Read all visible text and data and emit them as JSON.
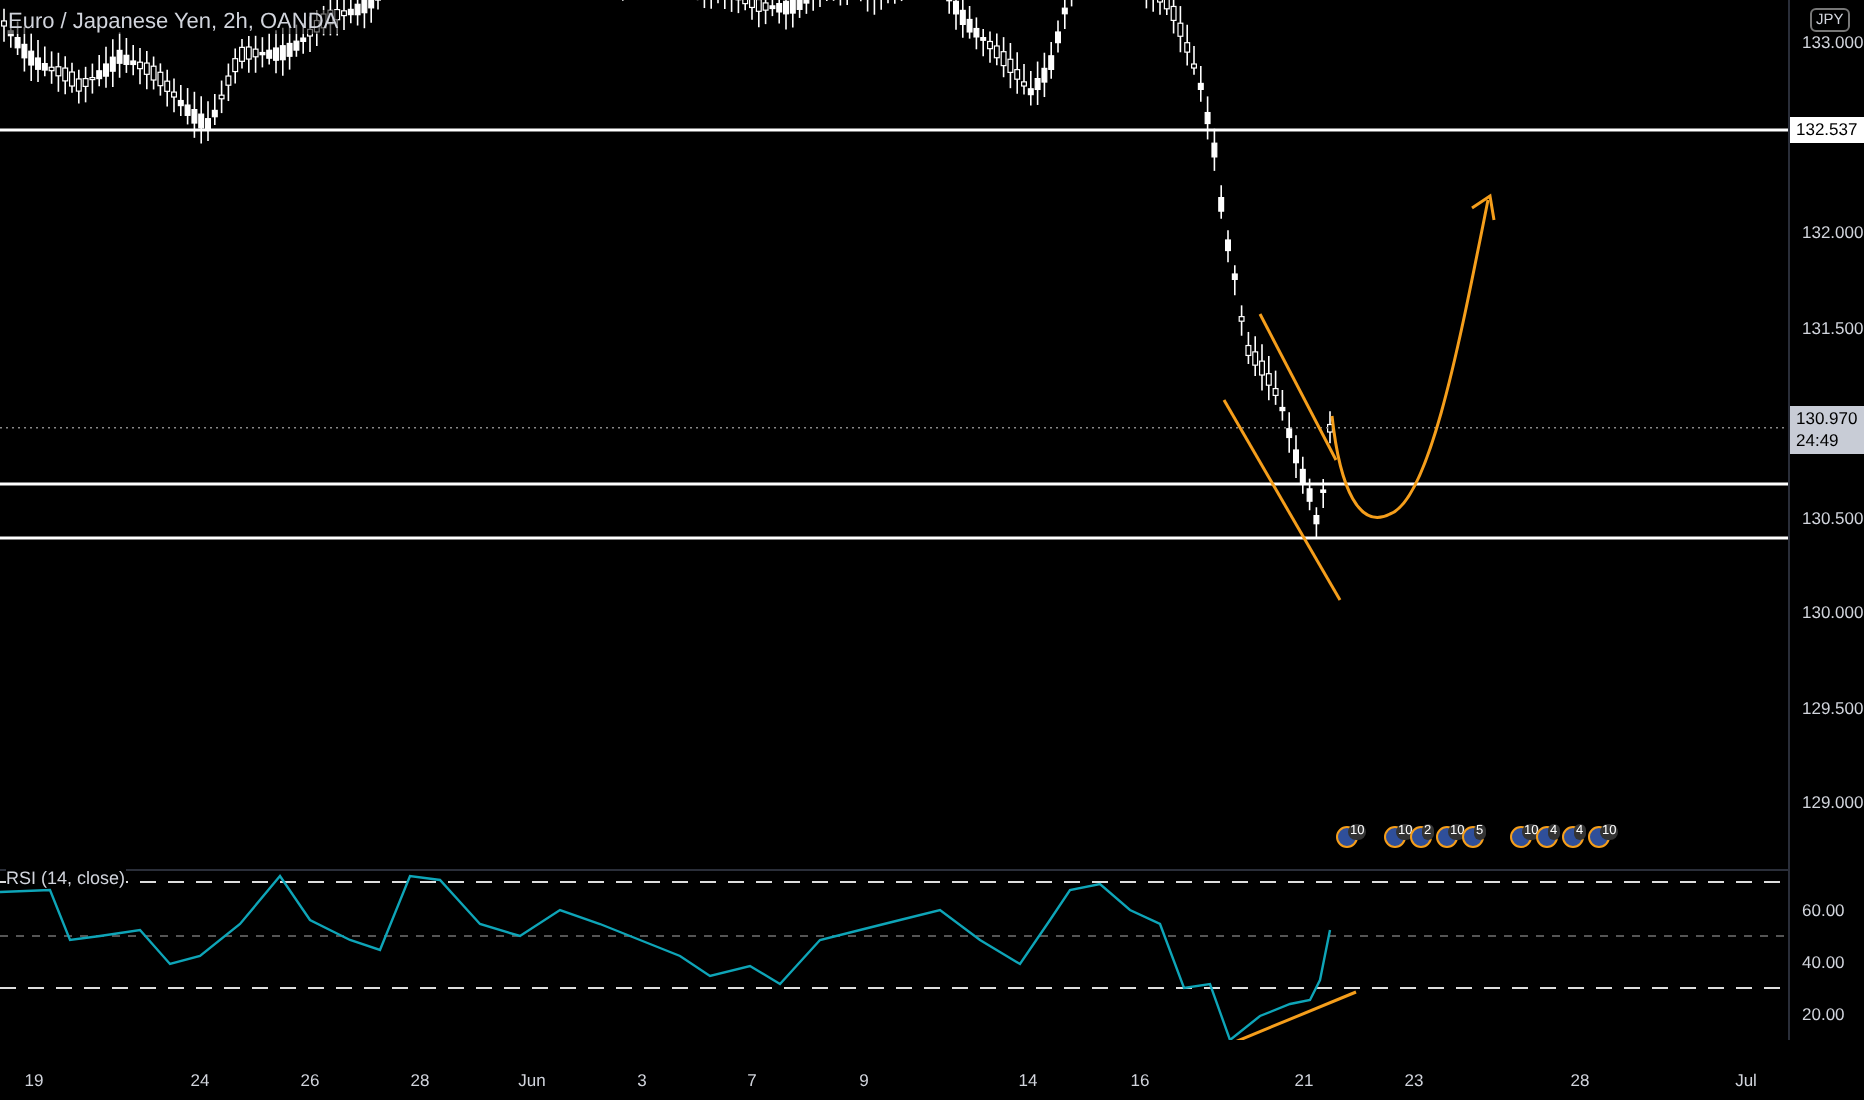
{
  "instrument": {
    "title": "Euro / Japanese Yen, 2h, OANDA"
  },
  "price_axis": {
    "currency": "JPY",
    "ticks": [
      "133.000",
      "132.000",
      "131.500",
      "130.500",
      "130.000",
      "129.500",
      "129.000"
    ],
    "level_labels": [
      {
        "text": "132.537",
        "kind": "line"
      },
      {
        "text": "130.970",
        "kind": "last",
        "countdown": "24:49"
      }
    ]
  },
  "events": [
    {
      "badges": [
        "10"
      ]
    },
    {
      "badges": [
        "10",
        "2",
        "10",
        "5"
      ]
    },
    {
      "badges": [
        "10",
        "4",
        "4",
        "10"
      ]
    }
  ],
  "rsi": {
    "title": "RSI (14, close)",
    "ticks": [
      "60.00",
      "40.00",
      "20.00"
    ]
  },
  "time_axis": {
    "labels": [
      "19",
      "24",
      "26",
      "28",
      "Jun",
      "3",
      "7",
      "9",
      "14",
      "16",
      "21",
      "23",
      "28",
      "Jul"
    ]
  }
}
